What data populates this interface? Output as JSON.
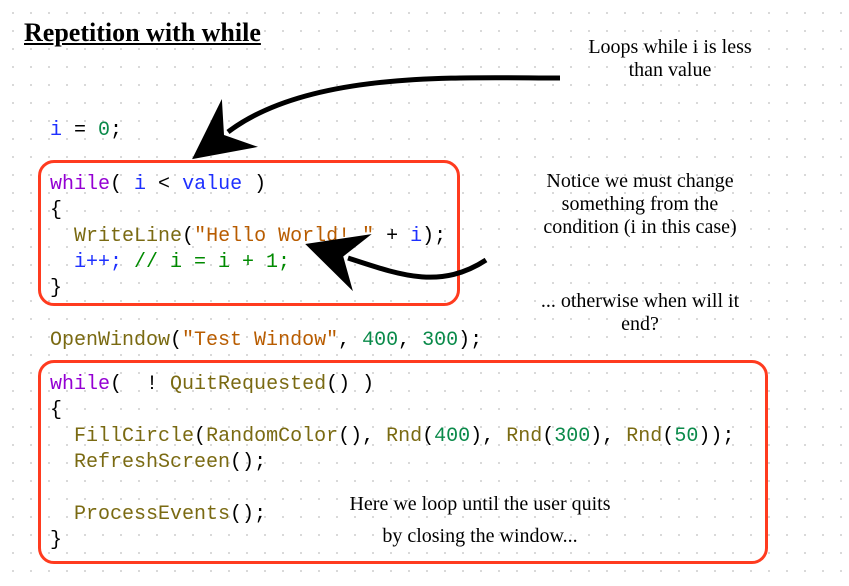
{
  "title": "Repetition with while",
  "annotations": {
    "a1": "Loops while i is less\nthan value",
    "a2": "Notice we must change\nsomething from the\ncondition (i in this case)",
    "a3": "... otherwise when will it\nend?",
    "a4": "Here we loop until the user quits\nby closing the window..."
  },
  "code": {
    "init_var": "i",
    "init_eq": " = ",
    "init_val": "0",
    "semi": ";",
    "while_kw": "while",
    "lp": "( ",
    "rp": " )",
    "cond_i": "i",
    "cond_lt": " < ",
    "cond_val": "value",
    "brace_o": "{",
    "brace_c": "}",
    "indent": "  ",
    "writeline": "WriteLine",
    "wl_open": "(",
    "wl_str": "\"Hello World! \"",
    "wl_plus": " + ",
    "wl_i": "i",
    "wl_close": ")",
    "inc_i": "i++;",
    "inc_cmt": " // i = i + 1;",
    "openwin": "OpenWindow",
    "ow_open": "(",
    "ow_str": "\"Test Window\"",
    "comma": ", ",
    "n400": "400",
    "n300": "300",
    "n50": "50",
    "ow_close": ")",
    "not": " ! ",
    "quitreq": "QuitRequested",
    "empty_p": "()",
    "fillcircle": "FillCircle",
    "randomcolor": "RandomColor",
    "rnd": "Rnd",
    "r_open": "(",
    "r_close": ")",
    "refresh": "RefreshScreen",
    "process": "ProcessEvents",
    "blank": ""
  }
}
